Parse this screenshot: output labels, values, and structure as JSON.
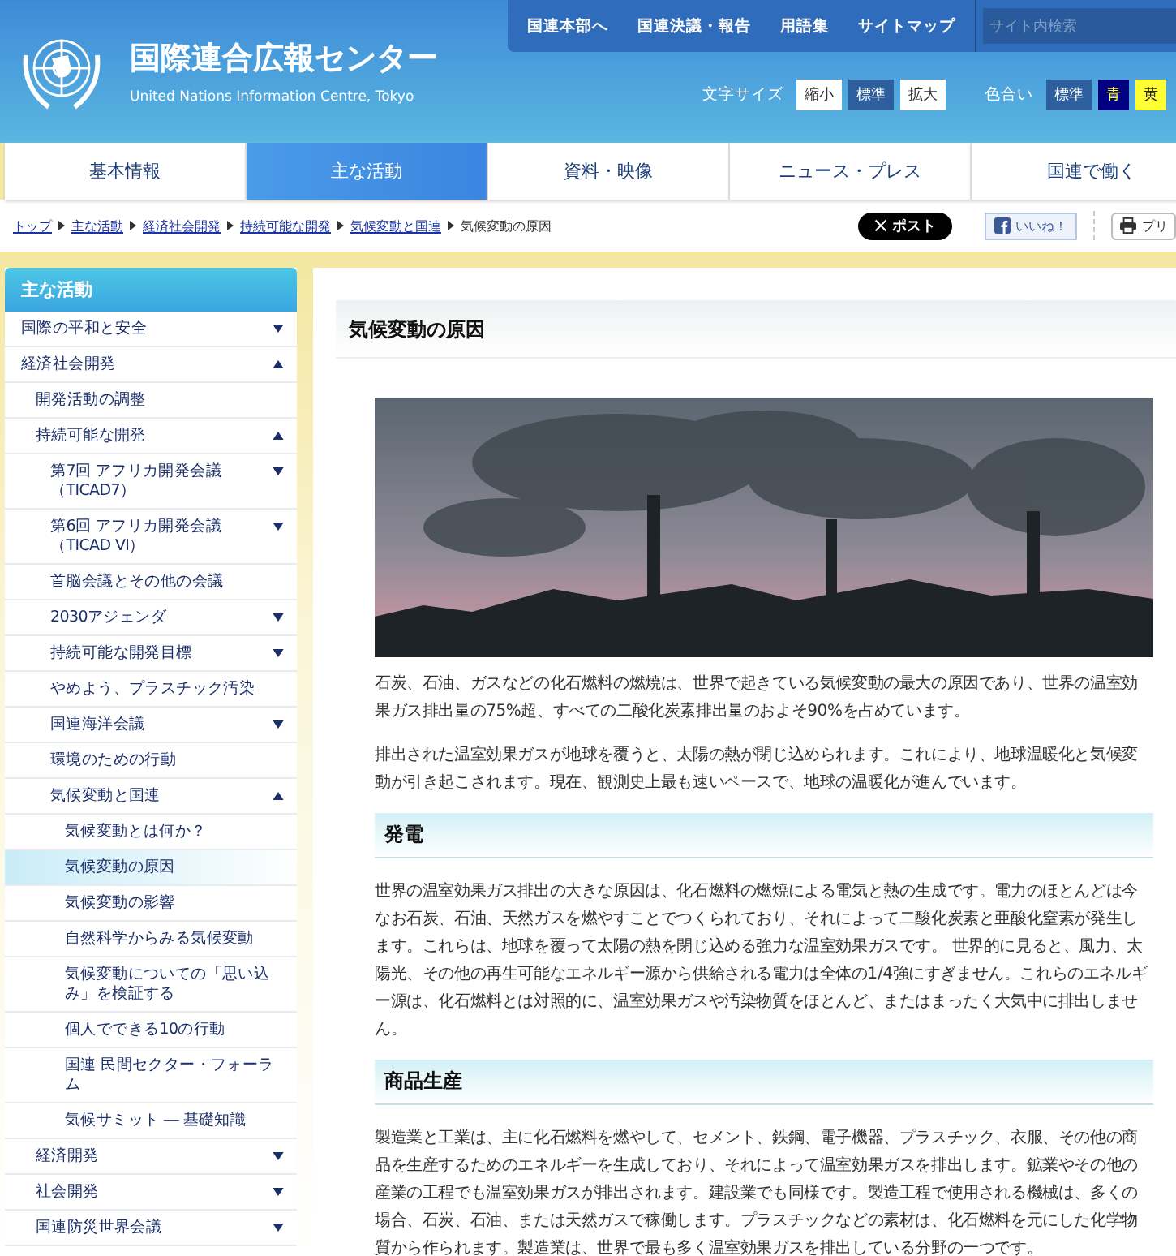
{
  "header": {
    "title": "国際連合広報センター",
    "subtitle": "United Nations Information Centre, Tokyo",
    "top_links": [
      "国連本部へ",
      "国連決議・報告",
      "用語集",
      "サイトマップ"
    ],
    "search": {
      "placeholder": "サイト内検索"
    },
    "font_size": {
      "label": "文字サイズ",
      "options": [
        {
          "label": "縮小",
          "selected": false
        },
        {
          "label": "標準",
          "selected": true
        },
        {
          "label": "拡大",
          "selected": false
        }
      ]
    },
    "color_scheme": {
      "label": "色合い",
      "options": [
        {
          "label": "標準",
          "color": "#2d5f9e"
        },
        {
          "label": "青",
          "color": "#000080"
        },
        {
          "label": "黄",
          "color": "#ffff33"
        }
      ]
    }
  },
  "nav_tabs": [
    {
      "label": "基本情報",
      "selected": false
    },
    {
      "label": "主な活動",
      "selected": true
    },
    {
      "label": "資料・映像",
      "selected": false
    },
    {
      "label": "ニュース・プレス",
      "selected": false
    },
    {
      "label": "国連で働く",
      "selected": false
    }
  ],
  "breadcrumb": {
    "links": [
      "トップ",
      "主な活動",
      "経済社会開発",
      "持続可能な開発",
      "気候変動と国連"
    ],
    "current": "気候変動の原因"
  },
  "share": {
    "post": "ポスト",
    "like": "いいね！",
    "print": "プリ"
  },
  "sidebar": {
    "title": "主な活動",
    "items": [
      {
        "label": "国際の平和と安全",
        "kind": "toggle",
        "expanded": false,
        "selected": false
      },
      {
        "label": "経済社会開発",
        "kind": "toggle",
        "expanded": true,
        "selected": false,
        "children": [
          {
            "label": "開発活動の調整",
            "kind": "link",
            "selected": false
          },
          {
            "label": "持続可能な開発",
            "kind": "toggle",
            "expanded": true,
            "selected": false,
            "children": [
              {
                "label": "第7回 アフリカ開発会議（TICAD7）",
                "kind": "toggle",
                "expanded": false,
                "selected": false
              },
              {
                "label": "第6回 アフリカ開発会議（TICAD VI）",
                "kind": "toggle",
                "expanded": false,
                "selected": false
              },
              {
                "label": "首脳会議とその他の会議",
                "kind": "link",
                "selected": false
              },
              {
                "label": "2030アジェンダ",
                "kind": "toggle",
                "expanded": false,
                "selected": false
              },
              {
                "label": "持続可能な開発目標",
                "kind": "toggle",
                "expanded": false,
                "selected": false
              },
              {
                "label": "やめよう、プラスチック汚染",
                "kind": "link",
                "selected": false
              },
              {
                "label": "国連海洋会議",
                "kind": "toggle",
                "expanded": false,
                "selected": false
              },
              {
                "label": "環境のための行動",
                "kind": "link",
                "selected": false
              },
              {
                "label": "気候変動と国連",
                "kind": "toggle",
                "expanded": true,
                "selected": false,
                "children": [
                  {
                    "label": "気候変動とは何か？",
                    "kind": "link",
                    "selected": false
                  },
                  {
                    "label": "気候変動の原因",
                    "kind": "link",
                    "selected": true
                  },
                  {
                    "label": "気候変動の影響",
                    "kind": "link",
                    "selected": false
                  },
                  {
                    "label": "自然科学からみる気候変動",
                    "kind": "link",
                    "selected": false
                  },
                  {
                    "label": "気候変動についての「思い込み」を検証する",
                    "kind": "link",
                    "selected": false
                  },
                  {
                    "label": "個人でできる10の行動",
                    "kind": "link",
                    "selected": false
                  },
                  {
                    "label": "国連 民間セクター・フォーラム",
                    "kind": "link",
                    "selected": false
                  },
                  {
                    "label": "気候サミット ― 基礎知識",
                    "kind": "link",
                    "selected": false
                  }
                ]
              }
            ]
          },
          {
            "label": "経済開発",
            "kind": "toggle",
            "expanded": false,
            "selected": false
          },
          {
            "label": "社会開発",
            "kind": "toggle",
            "expanded": false,
            "selected": false
          },
          {
            "label": "国連防災世界会議",
            "kind": "toggle",
            "expanded": false,
            "selected": false
          }
        ]
      }
    ]
  },
  "article": {
    "title": "気候変動の原因",
    "blocks": [
      {
        "kind": "paragraph",
        "text": "石炭、石油、ガスなどの化石燃料の燃焼は、世界で起きている気候変動の最大の原因であり、世界の温室効果ガス排出量の75%超、すべての二酸化炭素排出量のおよそ90%を占めています。"
      },
      {
        "kind": "paragraph",
        "text": "排出された温室効果ガスが地球を覆うと、太陽の熱が閉じ込められます。これにより、地球温暖化と気候変動が引き起こされます。現在、観測史上最も速いペースで、地球の温暖化が進んでいます。"
      },
      {
        "kind": "heading",
        "text": "発電"
      },
      {
        "kind": "paragraph",
        "text": "世界の温室効果ガス排出の大きな原因は、化石燃料の燃焼による電気と熱の生成です。電力のほとんどは今なお石炭、石油、天然ガスを燃やすことでつくられており、それによって二酸化炭素と亜酸化窒素が発生します。これらは、地球を覆って太陽の熱を閉じ込める強力な温室効果ガスです。 世界的に見ると、風力、太陽光、その他の再生可能なエネルギー源から供給される電力は全体の1/4強にすぎません。これらのエネルギー源は、化石燃料とは対照的に、温室効果ガスや汚染物質をほとんど、またはまったく大気中に排出しません。"
      },
      {
        "kind": "heading",
        "text": "商品生産"
      },
      {
        "kind": "paragraph",
        "text": "製造業と工業は、主に化石燃料を燃やして、セメント、鉄鋼、電子機器、プラスチック、衣服、その他の商品を生産するためのエネルギーを生成しており、それによって温室効果ガスを排出します。鉱業やその他の産業の工程でも温室効果ガスが排出されます。建設業でも同様です。製造工程で使用される機械は、多くの場合、石炭、石油、または天然ガスで稼働します。プラスチックなどの素材は、化石燃料を元にした化学物質から作られます。製造業は、世界で最も多く温室効果ガスを排出している分野の一つです。"
      }
    ]
  }
}
